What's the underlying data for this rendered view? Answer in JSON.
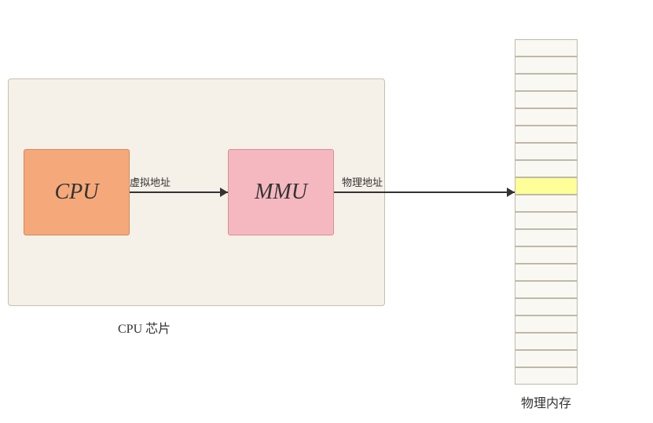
{
  "cpu_chip": {
    "label": "CPU 芯片"
  },
  "cpu_block": {
    "label": "CPU"
  },
  "mmu_block": {
    "label": "MMU"
  },
  "arrow_virtual": {
    "label": "虚拟地址"
  },
  "arrow_physical": {
    "label": "物理地址"
  },
  "memory": {
    "label": "物理内存",
    "total_cells": 20,
    "highlighted_cell": 8
  },
  "colors": {
    "cpu_bg": "#f5a97a",
    "mmu_bg": "#f5b8c0",
    "chip_bg": "#f5f0e8",
    "memory_bg": "#faf8f2",
    "highlight": "#ffff99"
  }
}
